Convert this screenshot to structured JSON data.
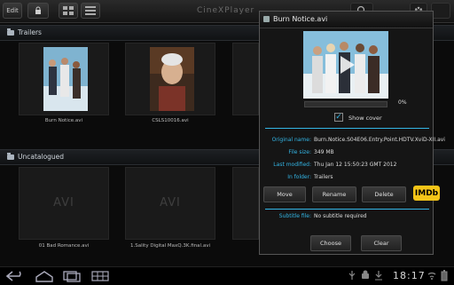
{
  "toolbar": {
    "edit_label": "Edit",
    "app_title": "CineXPlayer"
  },
  "sections": {
    "trailers_label": "Trailers",
    "uncatalogued_label": "Uncatalogued"
  },
  "tiles": {
    "row1": [
      "Burn Notice.avi",
      "CSLS10016.avi"
    ],
    "avi_text": "AVI",
    "row2": [
      "01 Bad Romance.avi",
      "1.Sality Digital MaxQ.3K.final.avi"
    ]
  },
  "dialog": {
    "title": "Burn Notice.avi",
    "progress_label": "0%",
    "progress_value": 0,
    "show_cover_label": "Show cover",
    "show_cover_checked": true,
    "fields": [
      {
        "label": "Original name:",
        "value": "Burn.Notice.S04E06.Entry.Point.HDTV.XviD-XII.avi"
      },
      {
        "label": "File size:",
        "value": "349 MB"
      },
      {
        "label": "Last modified:",
        "value": "Thu Jan 12 15:50:23 GMT 2012"
      },
      {
        "label": "In folder:",
        "value": "Trailers"
      }
    ],
    "buttons": {
      "move": "Move",
      "rename": "Rename",
      "delete": "Delete",
      "imdb": "IMDb"
    },
    "subtitle_label": "Subtitle file:",
    "subtitle_value": "No subtitle required",
    "choose": "Choose",
    "clear": "Clear"
  },
  "statusbar": {
    "clock": "18:17"
  },
  "colors": {
    "accent": "#33b5e5",
    "imdb": "#f5c518"
  }
}
